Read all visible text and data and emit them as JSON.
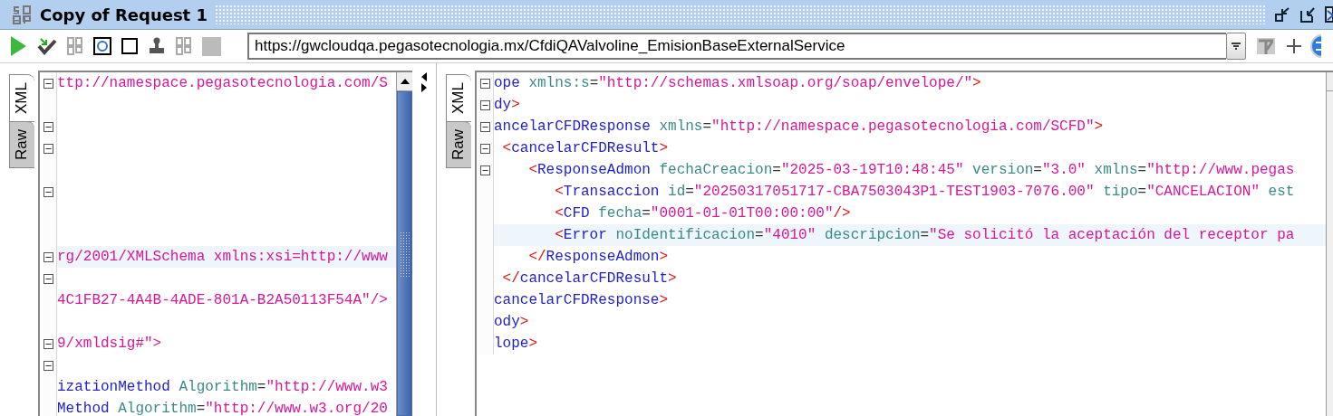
{
  "window": {
    "title": "Copy of Request 1"
  },
  "toolbar": {
    "endpoint": "https://gwcloudqa.pegasotecnologia.mx/CfdiQAValvoline_EmisionBaseExternalService"
  },
  "request_editor": {
    "tabs": [
      {
        "label": "XML",
        "selected": true
      },
      {
        "label": "Raw",
        "selected": false
      }
    ],
    "lines": [
      {
        "fold": true,
        "highlighted": false,
        "tokens": [
          {
            "kind": "value",
            "text": "ttp://namespace.pegasotecnologia.com/S"
          }
        ]
      },
      {
        "fold": false,
        "highlighted": false
      },
      {
        "fold": true,
        "highlighted": false
      },
      {
        "fold": true,
        "highlighted": false
      },
      {
        "fold": false,
        "highlighted": false
      },
      {
        "fold": true,
        "highlighted": false
      },
      {
        "fold": false,
        "highlighted": false
      },
      {
        "fold": false,
        "highlighted": false
      },
      {
        "fold": true,
        "highlighted": true,
        "tokens": [
          {
            "kind": "value",
            "text": "rg/2001/XMLSchema xmlns:xsi=http://www"
          }
        ]
      },
      {
        "fold": true,
        "highlighted": false
      },
      {
        "fold": false,
        "highlighted": false,
        "tokens": [
          {
            "kind": "value",
            "text": "4C1FB27-4A4B-4ADE-801A-B2A50113F54A\"/>"
          }
        ]
      },
      {
        "fold": false,
        "highlighted": false
      },
      {
        "fold": true,
        "highlighted": false,
        "tokens": [
          {
            "kind": "value",
            "text": "9/xmldsig#\">"
          }
        ]
      },
      {
        "fold": true,
        "highlighted": false
      },
      {
        "fold": false,
        "highlighted": false,
        "tokens": [
          {
            "kind": "tag",
            "text": "izationMethod"
          },
          {
            "kind": "attr",
            "text": " Algorithm"
          },
          {
            "kind": "plain",
            "text": "="
          },
          {
            "kind": "value",
            "text": "\"http://www.w3"
          }
        ]
      },
      {
        "fold": false,
        "highlighted": false,
        "tokens": [
          {
            "kind": "tag",
            "text": "Method"
          },
          {
            "kind": "attr",
            "text": " Algorithm"
          },
          {
            "kind": "plain",
            "text": "="
          },
          {
            "kind": "value",
            "text": "\"http://www.w3.org/20"
          }
        ]
      }
    ]
  },
  "response_editor": {
    "tabs": [
      {
        "label": "XML",
        "selected": true
      },
      {
        "label": "Raw",
        "selected": false
      }
    ],
    "lines": [
      {
        "fold": true,
        "highlighted": false,
        "tokens": [
          {
            "kind": "tag",
            "text": "ope"
          },
          {
            "kind": "attr",
            "text": " xmlns:s"
          },
          {
            "kind": "plain",
            "text": "="
          },
          {
            "kind": "value",
            "text": "\"http://schemas.xmlsoap.org/soap/envelope/\""
          },
          {
            "kind": "punct",
            "text": ">"
          }
        ]
      },
      {
        "fold": true,
        "highlighted": false,
        "tokens": [
          {
            "kind": "tag",
            "text": "dy"
          },
          {
            "kind": "punct",
            "text": ">"
          }
        ]
      },
      {
        "fold": true,
        "highlighted": false,
        "tokens": [
          {
            "kind": "tag",
            "text": "ancelarCFDResponse"
          },
          {
            "kind": "attr",
            "text": " xmlns"
          },
          {
            "kind": "plain",
            "text": "="
          },
          {
            "kind": "value",
            "text": "\"http://namespace.pegasotecnologia.com/SCFD\""
          },
          {
            "kind": "punct",
            "text": ">"
          }
        ]
      },
      {
        "fold": true,
        "highlighted": false,
        "tokens": [
          {
            "kind": "punct",
            "text": " <"
          },
          {
            "kind": "tag",
            "text": "cancelarCFDResult"
          },
          {
            "kind": "punct",
            "text": ">"
          }
        ]
      },
      {
        "fold": true,
        "highlighted": false,
        "tokens": [
          {
            "kind": "punct",
            "text": "    <"
          },
          {
            "kind": "tag",
            "text": "ResponseAdmon"
          },
          {
            "kind": "attr",
            "text": " fechaCreacion"
          },
          {
            "kind": "plain",
            "text": "="
          },
          {
            "kind": "value",
            "text": "\"2025-03-19T10:48:45\""
          },
          {
            "kind": "attr",
            "text": " version"
          },
          {
            "kind": "plain",
            "text": "="
          },
          {
            "kind": "value",
            "text": "\"3.0\""
          },
          {
            "kind": "attr",
            "text": " xmlns"
          },
          {
            "kind": "plain",
            "text": "="
          },
          {
            "kind": "value",
            "text": "\"http://www.pegas"
          }
        ]
      },
      {
        "fold": false,
        "highlighted": false,
        "tokens": [
          {
            "kind": "punct",
            "text": "       <"
          },
          {
            "kind": "tag",
            "text": "Transaccion"
          },
          {
            "kind": "attr",
            "text": " id"
          },
          {
            "kind": "plain",
            "text": "="
          },
          {
            "kind": "value",
            "text": "\"20250317051717-CBA7503043P1-TEST1903-7076.00\""
          },
          {
            "kind": "attr",
            "text": " tipo"
          },
          {
            "kind": "plain",
            "text": "="
          },
          {
            "kind": "value",
            "text": "\"CANCELACION\""
          },
          {
            "kind": "attr",
            "text": " est"
          }
        ]
      },
      {
        "fold": false,
        "highlighted": false,
        "tokens": [
          {
            "kind": "punct",
            "text": "       <"
          },
          {
            "kind": "tag",
            "text": "CFD"
          },
          {
            "kind": "attr",
            "text": " fecha"
          },
          {
            "kind": "plain",
            "text": "="
          },
          {
            "kind": "value",
            "text": "\"0001-01-01T00:00:00\""
          },
          {
            "kind": "punct",
            "text": "/>"
          }
        ]
      },
      {
        "fold": false,
        "highlighted": true,
        "tokens": [
          {
            "kind": "punct",
            "text": "       <"
          },
          {
            "kind": "tag",
            "text": "Error"
          },
          {
            "kind": "attr",
            "text": " noIdentificacion"
          },
          {
            "kind": "plain",
            "text": "="
          },
          {
            "kind": "value",
            "text": "\"4010\""
          },
          {
            "kind": "attr",
            "text": " descripcion"
          },
          {
            "kind": "plain",
            "text": "="
          },
          {
            "kind": "value",
            "text": "\"Se solicitó la aceptación del receptor pa"
          }
        ]
      },
      {
        "fold": false,
        "highlighted": false,
        "tokens": [
          {
            "kind": "punct",
            "text": "    </"
          },
          {
            "kind": "tag",
            "text": "ResponseAdmon"
          },
          {
            "kind": "punct",
            "text": ">"
          }
        ]
      },
      {
        "fold": false,
        "highlighted": false,
        "tokens": [
          {
            "kind": "punct",
            "text": " </"
          },
          {
            "kind": "tag",
            "text": "cancelarCFDResult"
          },
          {
            "kind": "punct",
            "text": ">"
          }
        ]
      },
      {
        "fold": false,
        "highlighted": false,
        "tokens": [
          {
            "kind": "tag",
            "text": "cancelarCFDResponse"
          },
          {
            "kind": "punct",
            "text": ">"
          }
        ]
      },
      {
        "fold": false,
        "highlighted": false,
        "tokens": [
          {
            "kind": "tag",
            "text": "ody"
          },
          {
            "kind": "punct",
            "text": ">"
          }
        ]
      },
      {
        "fold": false,
        "highlighted": false,
        "tokens": [
          {
            "kind": "tag",
            "text": "lope"
          },
          {
            "kind": "punct",
            "text": ">"
          }
        ]
      }
    ]
  }
}
